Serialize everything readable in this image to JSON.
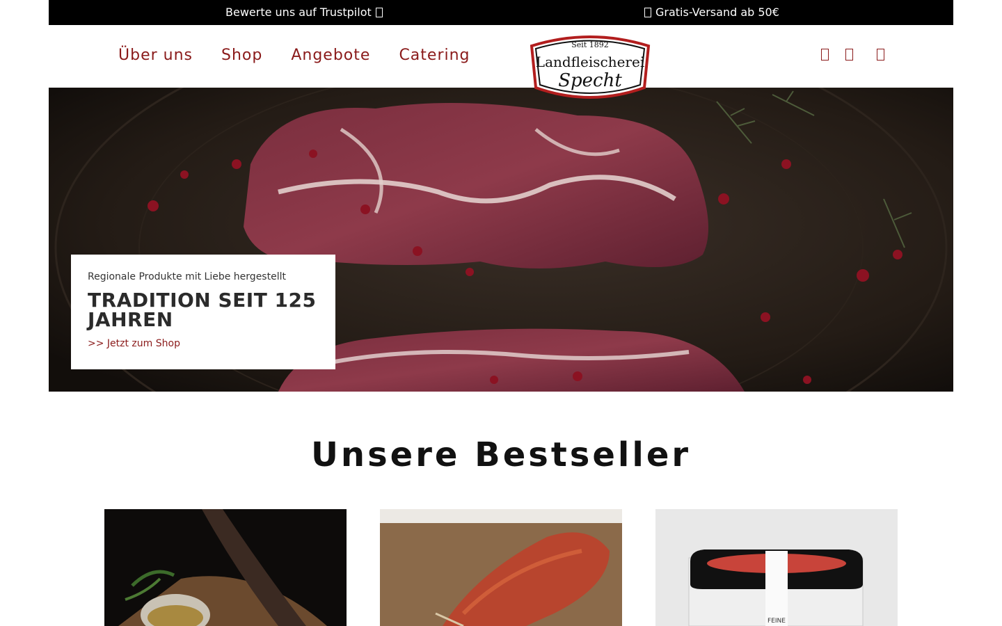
{
  "topbar": {
    "left_text": "Bewerte uns auf Trustpilot",
    "left_icon": "star-icon",
    "right_text": "Gratis-Versand ab 50€",
    "right_icon": "truck-icon"
  },
  "nav": {
    "items": [
      {
        "label": "Über uns"
      },
      {
        "label": "Shop"
      },
      {
        "label": "Angebote"
      },
      {
        "label": "Catering"
      }
    ]
  },
  "logo": {
    "since": "Seit 1892",
    "line1": "Landfleischerei",
    "line2": "Specht"
  },
  "header_icons": [
    "search-icon",
    "account-icon",
    "cart-icon"
  ],
  "hero": {
    "subtitle": "Regionale Produkte mit Liebe hergestellt",
    "title_line1": "TRADITION SEIT 125",
    "title_line2": "JAHREN",
    "cta": ">> Jetzt zum Shop"
  },
  "bestseller": {
    "title": "Unsere Bestseller"
  },
  "colors": {
    "accent": "#8a1a1a",
    "topbar_bg": "#000000",
    "text_dark": "#2b2b2b"
  }
}
